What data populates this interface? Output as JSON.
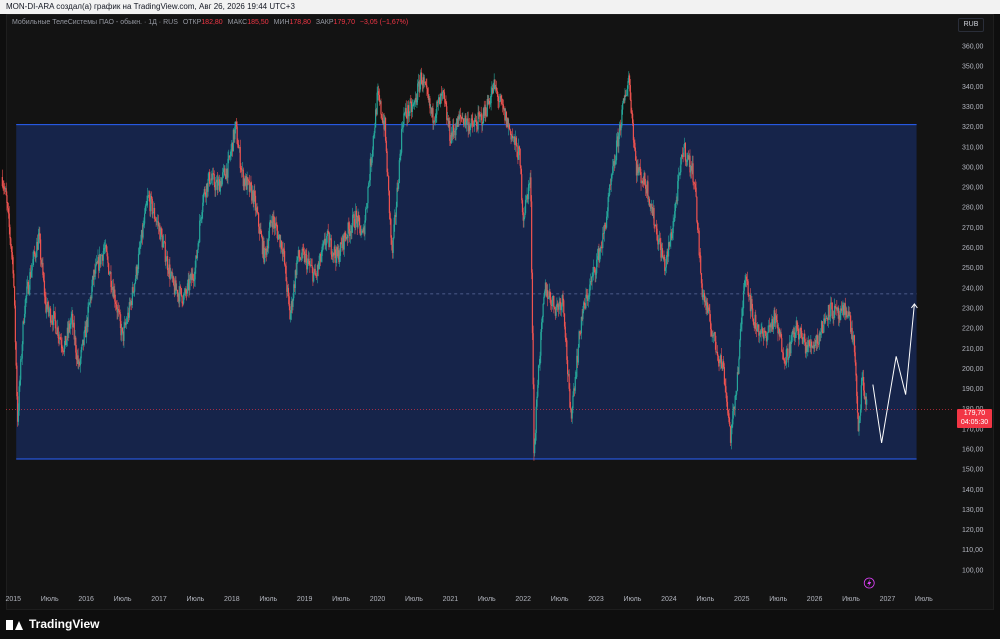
{
  "header": {
    "attribution": "MON-DI-ARA создал(а) график на TradingView.com, Авг 26, 2026 19:44 UTC+3"
  },
  "legend": {
    "symbol": "Мобильные ТелеСистемы ПАО - обыкн. · 1Д · RUS",
    "open_label": "ОТКР",
    "open_value": "182,80",
    "high_label": "МАКС",
    "high_value": "185,50",
    "low_label": "МИН",
    "low_value": "178,80",
    "close_label": "ЗАКР",
    "close_value": "179,70",
    "change": "−3,05 (−1,67%)"
  },
  "currency_button": "RUB",
  "price_tag": {
    "price": "179,70",
    "countdown": "04:05:30"
  },
  "branding": {
    "logo_text": "TradingView"
  },
  "colors": {
    "up": "#26a69a",
    "down": "#ef5350",
    "range_fill": "#16244a",
    "range_border": "#2962ff",
    "price_line": "#f23645",
    "mid_line": "#5c6b9e"
  },
  "icons": {
    "event_marker": "lightning-icon"
  },
  "chart_data": {
    "type": "candlestick",
    "title": "",
    "xlabel": "",
    "ylabel": "",
    "ylim": [
      90,
      366
    ],
    "y_ticks": [
      360,
      350,
      340,
      330,
      320,
      310,
      300,
      290,
      280,
      270,
      260,
      250,
      240,
      230,
      220,
      210,
      200,
      190,
      180,
      170,
      160,
      150,
      140,
      130,
      120,
      110,
      100
    ],
    "y_tick_labels": [
      "360,00",
      "350,00",
      "340,00",
      "330,00",
      "320,00",
      "310,00",
      "300,00",
      "290,00",
      "280,00",
      "270,00",
      "260,00",
      "250,00",
      "240,00",
      "230,00",
      "220,00",
      "210,00",
      "200,00",
      "190,00",
      "180,00",
      "170,00",
      "160,00",
      "150,00",
      "140,00",
      "130,00",
      "120,00",
      "110,00",
      "100,00"
    ],
    "x_range": [
      2014.9,
      2027.9
    ],
    "x_ticks": [
      2015.0,
      2015.5,
      2016.0,
      2016.5,
      2017.0,
      2017.5,
      2018.0,
      2018.5,
      2019.0,
      2019.5,
      2020.0,
      2020.5,
      2021.0,
      2021.5,
      2022.0,
      2022.5,
      2023.0,
      2023.5,
      2024.0,
      2024.5,
      2025.0,
      2025.5,
      2026.0,
      2026.5,
      2027.0,
      2027.5
    ],
    "x_tick_labels": [
      "2015",
      "Июль",
      "2016",
      "Июль",
      "2017",
      "Июль",
      "2018",
      "Июль",
      "2019",
      "Июль",
      "2020",
      "Июль",
      "2021",
      "Июль",
      "2022",
      "Июль",
      "2023",
      "Июль",
      "2024",
      "Июль",
      "2025",
      "Июль",
      "2026",
      "Июль",
      "2027",
      "Июль"
    ],
    "series_points": [
      [
        2014.85,
        295
      ],
      [
        2014.9,
        285
      ],
      [
        2015.0,
        250
      ],
      [
        2015.06,
        175
      ],
      [
        2015.15,
        230
      ],
      [
        2015.25,
        250
      ],
      [
        2015.35,
        265
      ],
      [
        2015.45,
        230
      ],
      [
        2015.55,
        225
      ],
      [
        2015.7,
        210
      ],
      [
        2015.8,
        225
      ],
      [
        2015.9,
        200
      ],
      [
        2016.0,
        220
      ],
      [
        2016.1,
        245
      ],
      [
        2016.25,
        260
      ],
      [
        2016.4,
        235
      ],
      [
        2016.5,
        215
      ],
      [
        2016.6,
        230
      ],
      [
        2016.7,
        250
      ],
      [
        2016.85,
        285
      ],
      [
        2017.0,
        270
      ],
      [
        2017.1,
        255
      ],
      [
        2017.2,
        240
      ],
      [
        2017.35,
        235
      ],
      [
        2017.5,
        250
      ],
      [
        2017.6,
        285
      ],
      [
        2017.7,
        295
      ],
      [
        2017.8,
        290
      ],
      [
        2017.95,
        300
      ],
      [
        2018.05,
        320
      ],
      [
        2018.15,
        295
      ],
      [
        2018.3,
        285
      ],
      [
        2018.45,
        255
      ],
      [
        2018.55,
        275
      ],
      [
        2018.7,
        260
      ],
      [
        2018.8,
        225
      ],
      [
        2018.9,
        255
      ],
      [
        2019.0,
        255
      ],
      [
        2019.15,
        245
      ],
      [
        2019.3,
        265
      ],
      [
        2019.45,
        255
      ],
      [
        2019.55,
        265
      ],
      [
        2019.7,
        275
      ],
      [
        2019.8,
        265
      ],
      [
        2019.9,
        300
      ],
      [
        2020.0,
        335
      ],
      [
        2020.1,
        320
      ],
      [
        2020.2,
        255
      ],
      [
        2020.35,
        325
      ],
      [
        2020.5,
        330
      ],
      [
        2020.6,
        345
      ],
      [
        2020.75,
        325
      ],
      [
        2020.9,
        335
      ],
      [
        2021.0,
        315
      ],
      [
        2021.15,
        325
      ],
      [
        2021.3,
        320
      ],
      [
        2021.45,
        325
      ],
      [
        2021.6,
        340
      ],
      [
        2021.75,
        325
      ],
      [
        2021.85,
        315
      ],
      [
        2021.95,
        305
      ],
      [
        2022.0,
        275
      ],
      [
        2022.1,
        295
      ],
      [
        2022.15,
        155
      ],
      [
        2022.2,
        195
      ],
      [
        2022.3,
        240
      ],
      [
        2022.45,
        230
      ],
      [
        2022.55,
        235
      ],
      [
        2022.65,
        175
      ],
      [
        2022.8,
        225
      ],
      [
        2022.95,
        245
      ],
      [
        2023.1,
        265
      ],
      [
        2023.2,
        290
      ],
      [
        2023.35,
        325
      ],
      [
        2023.45,
        345
      ],
      [
        2023.55,
        300
      ],
      [
        2023.7,
        290
      ],
      [
        2023.85,
        265
      ],
      [
        2023.95,
        250
      ],
      [
        2024.05,
        270
      ],
      [
        2024.2,
        310
      ],
      [
        2024.35,
        295
      ],
      [
        2024.45,
        240
      ],
      [
        2024.55,
        225
      ],
      [
        2024.65,
        210
      ],
      [
        2024.75,
        200
      ],
      [
        2024.85,
        165
      ],
      [
        2024.95,
        200
      ],
      [
        2025.05,
        250
      ],
      [
        2025.15,
        225
      ],
      [
        2025.3,
        215
      ],
      [
        2025.45,
        225
      ],
      [
        2025.6,
        205
      ],
      [
        2025.75,
        220
      ],
      [
        2025.9,
        210
      ],
      [
        2026.05,
        215
      ],
      [
        2026.2,
        230
      ],
      [
        2026.35,
        225
      ],
      [
        2026.45,
        230
      ],
      [
        2026.55,
        210
      ],
      [
        2026.6,
        165
      ],
      [
        2026.65,
        195
      ],
      [
        2026.72,
        180
      ]
    ],
    "projection": [
      [
        2026.8,
        192
      ],
      [
        2026.92,
        163
      ],
      [
        2027.12,
        206
      ],
      [
        2027.25,
        187
      ],
      [
        2027.37,
        232
      ]
    ],
    "range_box": {
      "x": [
        2015.04,
        2027.4
      ],
      "y": [
        155,
        321
      ]
    },
    "mid_line": 237,
    "last_price": 179.7,
    "event_marker_x": 2026.75
  }
}
